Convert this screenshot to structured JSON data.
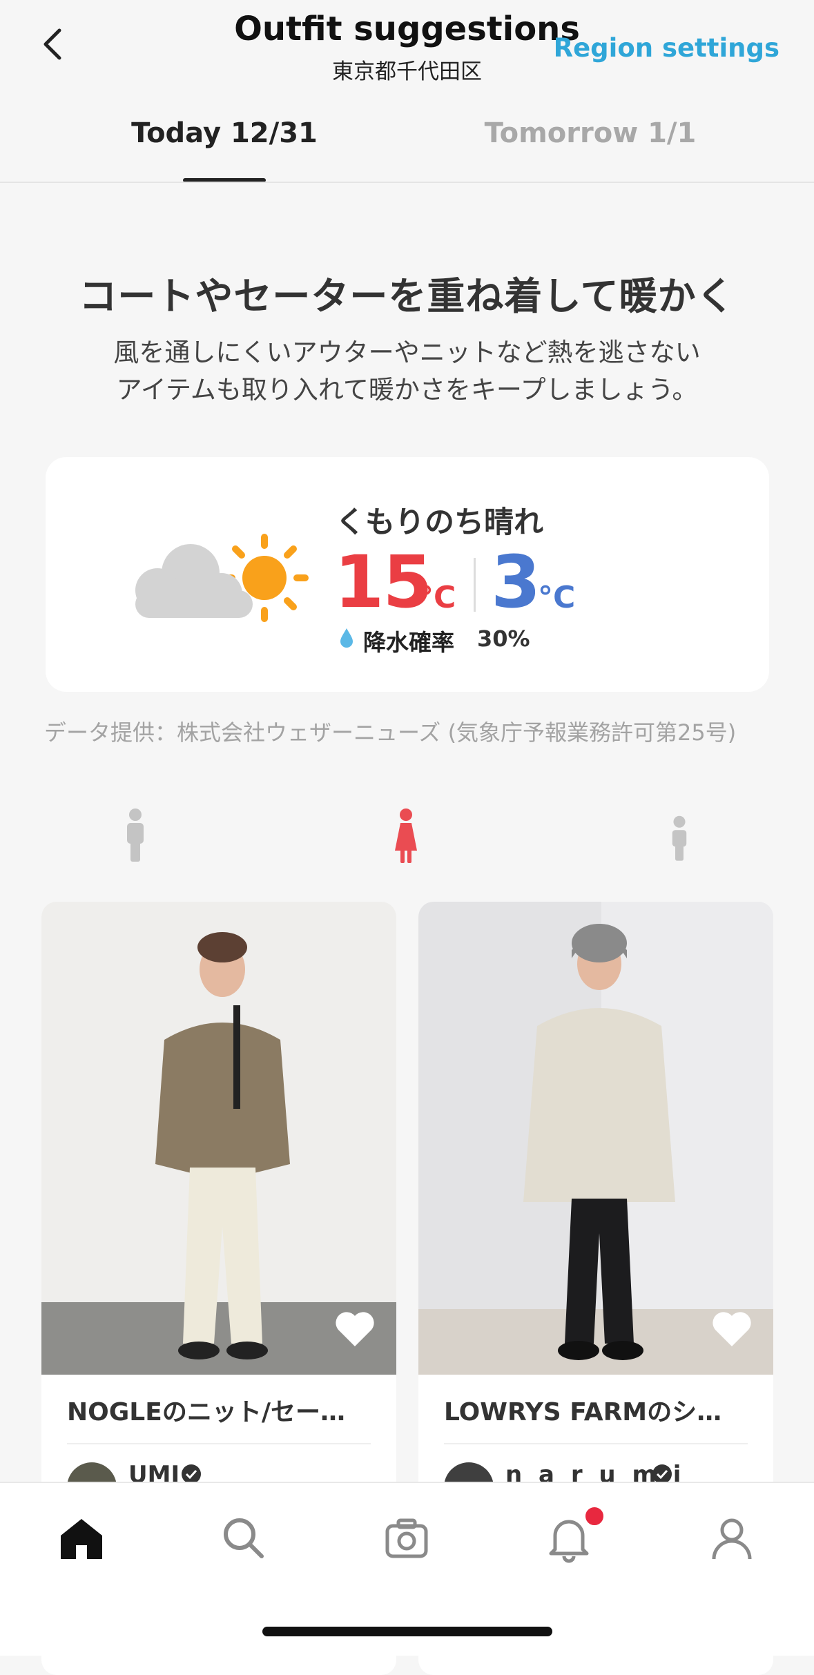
{
  "header": {
    "title": "Outfit suggestions",
    "subtitle": "東京都千代田区",
    "region_settings": "Region settings"
  },
  "tabs": [
    {
      "label": "Today 12/31",
      "active": true
    },
    {
      "label": "Tomorrow 1/1",
      "active": false
    }
  ],
  "advice": {
    "headline": "コートやセーターを重ね着して暖かく",
    "desc_line1": "風を通しにくいアウターやニットなど熱を逃さない",
    "desc_line2": "アイテムも取り入れて暖かさをキープしましょう。"
  },
  "weather": {
    "condition": "くもりのち晴れ",
    "high": "15",
    "high_unit": "°C",
    "low": "3",
    "low_unit": "°C",
    "rain_label": "降水確率",
    "rain_value": "30%",
    "icon": "cloudy-then-sunny-icon"
  },
  "credit": "データ提供：株式会社ウェザーニューズ (気象庁予報業務許可第25号)",
  "gender_filter": {
    "options": [
      "men-icon",
      "women-icon",
      "kids-icon"
    ],
    "selected": "women-icon"
  },
  "outfits": [
    {
      "title": "NOGLEのニット/セー…",
      "user": "UMI"
    },
    {
      "title": "LOWRYS FARMのシ…",
      "user": "n a r u m i"
    }
  ],
  "nav": {
    "items": [
      "home-icon",
      "search-icon",
      "camera-icon",
      "bell-icon",
      "profile-icon"
    ],
    "active": "home-icon"
  },
  "colors": {
    "accent": "#2fa6d8",
    "high_temp": "#ea3e43",
    "low_temp": "#4a78cf",
    "selected_gender": "#ea4c52",
    "badge": "#e8283f"
  }
}
